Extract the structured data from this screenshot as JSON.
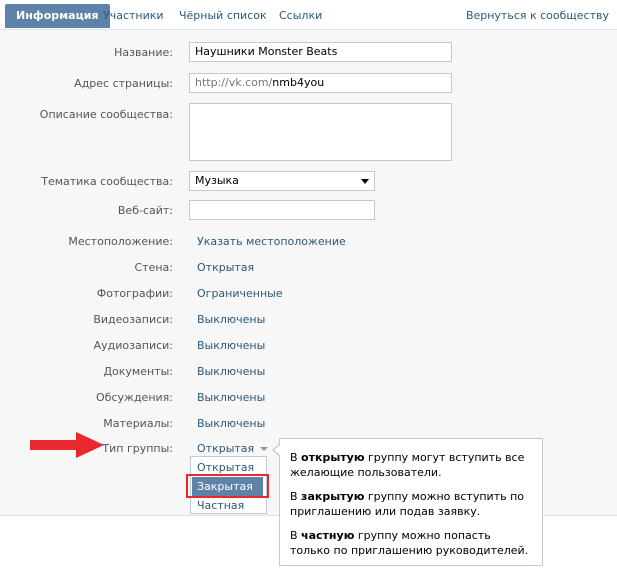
{
  "tabs": [
    {
      "label": "Информация",
      "active": true
    },
    {
      "label": "Участники"
    },
    {
      "label": "Чёрный список"
    },
    {
      "label": "Ссылки"
    }
  ],
  "back_link": "Вернуться к сообществу",
  "form": {
    "name": {
      "label": "Название:",
      "value": "Наушники Monster Beats"
    },
    "address": {
      "label": "Адрес страницы:",
      "prefix": "http://vk.com/",
      "value": "nmb4you"
    },
    "description": {
      "label": "Описание сообщества:",
      "value": ""
    },
    "topic": {
      "label": "Тематика сообщества:",
      "value": "Музыка"
    },
    "website": {
      "label": "Веб-сайт:",
      "value": ""
    },
    "location": {
      "label": "Местоположение:",
      "value": "Указать местоположение"
    },
    "wall": {
      "label": "Стена:",
      "value": "Открытая"
    },
    "photos": {
      "label": "Фотографии:",
      "value": "Ограниченные"
    },
    "videos": {
      "label": "Видеозаписи:",
      "value": "Выключены"
    },
    "audio": {
      "label": "Аудиозаписи:",
      "value": "Выключены"
    },
    "documents": {
      "label": "Документы:",
      "value": "Выключены"
    },
    "discussions": {
      "label": "Обсуждения:",
      "value": "Выключены"
    },
    "materials": {
      "label": "Материалы:",
      "value": "Выключены"
    },
    "group_type": {
      "label": "Тип группы:",
      "value": "Открытая",
      "options": [
        "Открытая",
        "Закрытая",
        "Частная"
      ],
      "highlighted": "Закрытая"
    }
  },
  "tooltip": {
    "open": {
      "pre": "В ",
      "bold": "открытую",
      "post": " группу могут вступить все желающие пользователи."
    },
    "closed": {
      "pre": "В ",
      "bold": "закрытую",
      "post": " группу можно вступить по приглашению или подав заявку."
    },
    "private": {
      "pre": "В ",
      "bold": "частную",
      "post": " группу можно попасть только по приглашению руководителей."
    }
  },
  "colors": {
    "accent": "#5e82a8",
    "link": "#2b587a",
    "highlight": "#e8282c"
  }
}
